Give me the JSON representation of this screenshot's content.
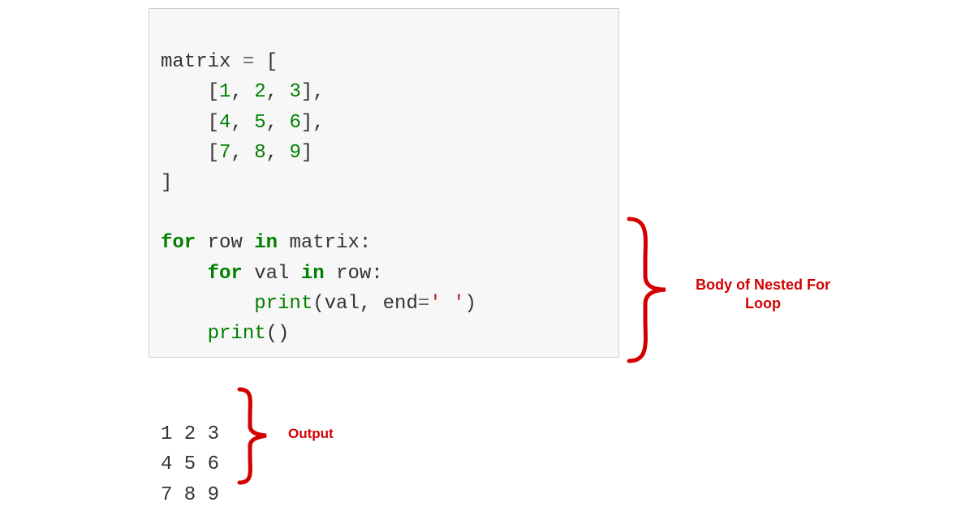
{
  "code": {
    "line1_var": "matrix",
    "line1_eq": " = ",
    "line1_bracket": "[",
    "row1_open": "    [",
    "row1_n1": "1",
    "row1_c1": ", ",
    "row1_n2": "2",
    "row1_c2": ", ",
    "row1_n3": "3",
    "row1_close": "],",
    "row2_open": "    [",
    "row2_n1": "4",
    "row2_c1": ", ",
    "row2_n2": "5",
    "row2_c2": ", ",
    "row2_n3": "6",
    "row2_close": "],",
    "row3_open": "    [",
    "row3_n1": "7",
    "row3_c1": ", ",
    "row3_n2": "8",
    "row3_c2": ", ",
    "row3_n3": "9",
    "row3_close": "]",
    "close_bracket": "]",
    "blank": "",
    "for1_kw": "for",
    "for1_var": " row ",
    "for1_in": "in",
    "for1_rest": " matrix:",
    "for2_indent": "    ",
    "for2_kw": "for",
    "for2_var": " val ",
    "for2_in": "in",
    "for2_rest": " row:",
    "print1_indent": "        ",
    "print1_fn": "print",
    "print1_open": "(val, end",
    "print1_eq": "=",
    "print1_str": "' '",
    "print1_close": ")",
    "print2_indent": "    ",
    "print2_fn": "print",
    "print2_rest": "()"
  },
  "output": {
    "line1": "1 2 3",
    "line2": "4 5 6",
    "line3": "7 8 9"
  },
  "labels": {
    "body": "Body of Nested For Loop",
    "output": "Output"
  },
  "colors": {
    "brace": "#d40000",
    "label": "#d40000",
    "code_bg": "#f7f7f7"
  }
}
